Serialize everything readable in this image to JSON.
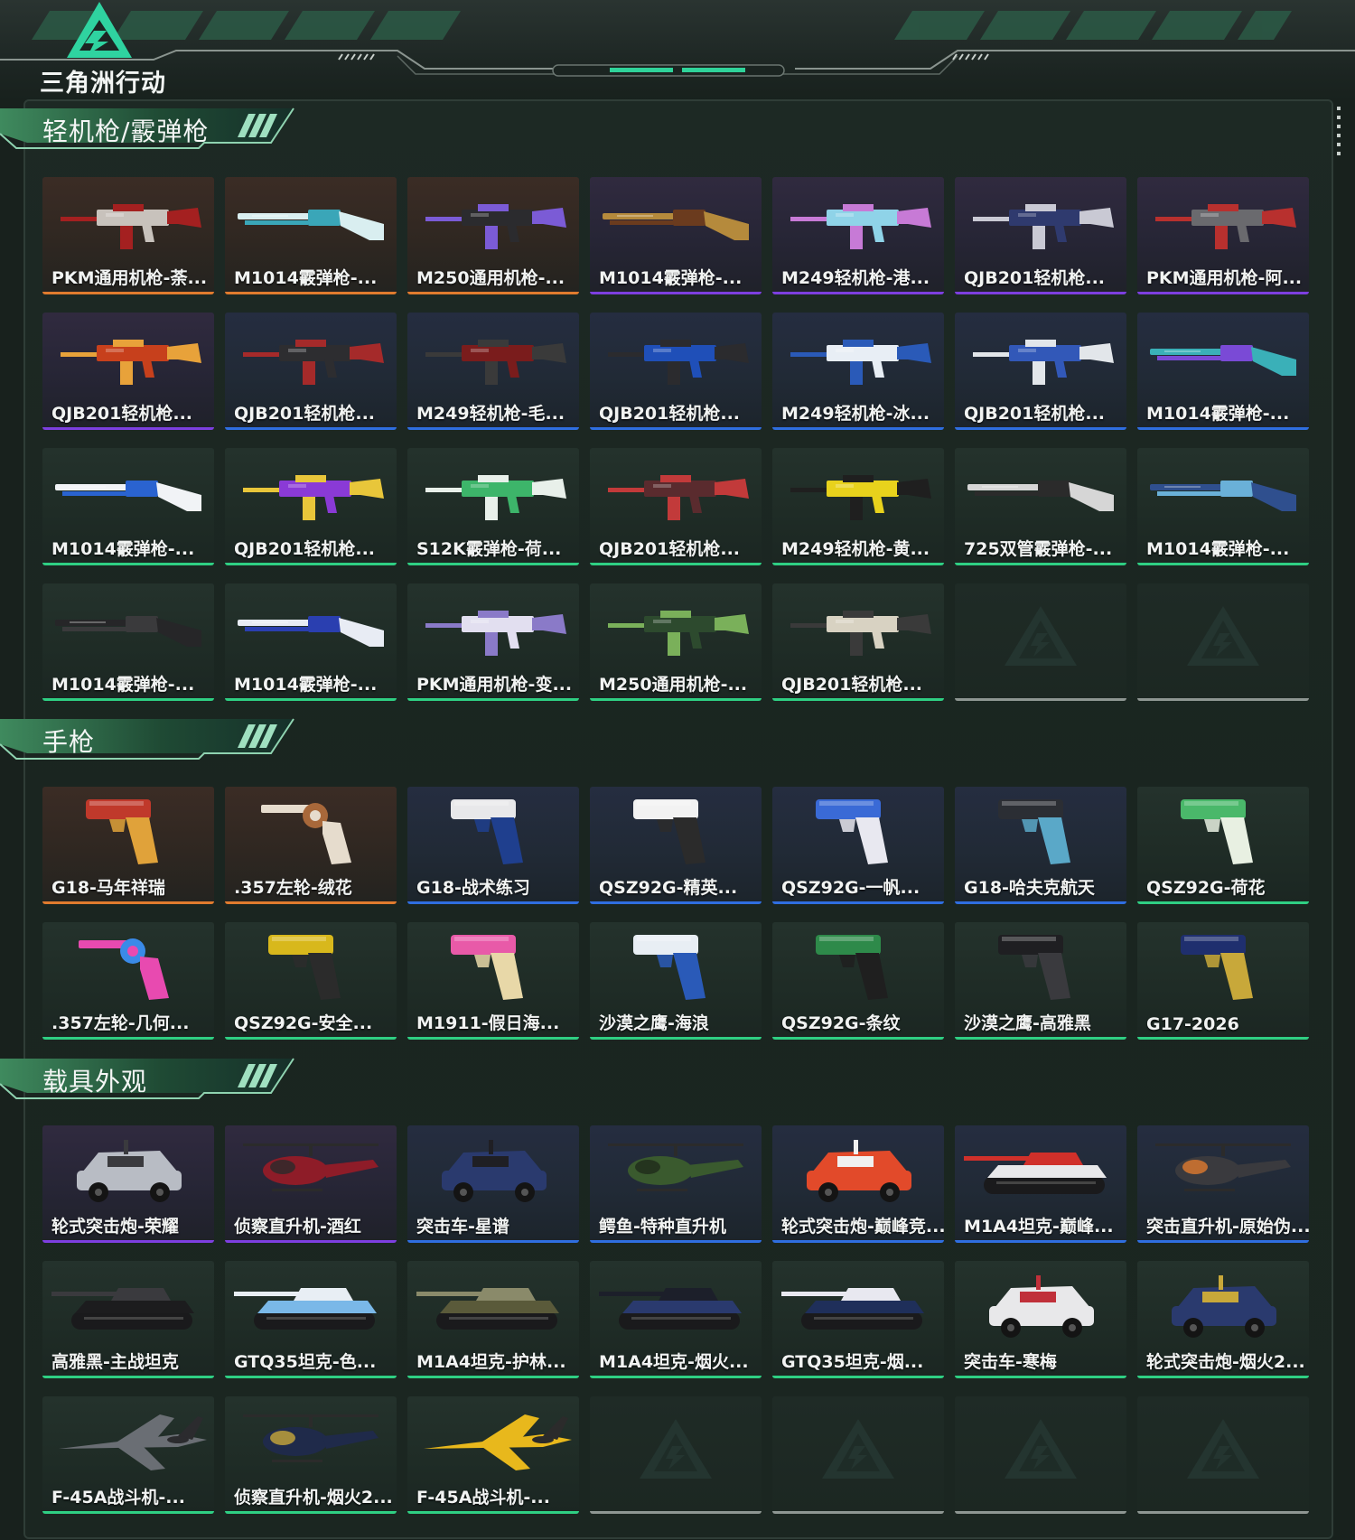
{
  "app": {
    "logo_text": "三角洲行动"
  },
  "colors": {
    "orange": "#e07b2e",
    "purple": "#7d3fe0",
    "blue": "#2f6ee0",
    "green": "#2fcf83",
    "empty": "#8e9692"
  },
  "sections": [
    {
      "title": "轻机枪/霰弹枪",
      "items": [
        {
          "label": "PKM通用机枪-荼...",
          "rarity": "orange",
          "kind": "rifle",
          "c1": "#c8c2bc",
          "c2": "#a42020"
        },
        {
          "label": "M1014霰弹枪-...",
          "rarity": "orange",
          "kind": "shotgun",
          "c1": "#d9eef0",
          "c2": "#3aa6b8"
        },
        {
          "label": "M250通用机枪-...",
          "rarity": "orange",
          "kind": "rifle",
          "c1": "#2b2b2e",
          "c2": "#7b5bd6"
        },
        {
          "label": "M1014霰弹枪-...",
          "rarity": "purple",
          "kind": "shotgun",
          "c1": "#b58a3c",
          "c2": "#6b3b1e"
        },
        {
          "label": "M249轻机枪-港...",
          "rarity": "purple",
          "kind": "rifle",
          "c1": "#8fd3e8",
          "c2": "#c77ad6"
        },
        {
          "label": "QJB201轻机枪...",
          "rarity": "purple",
          "kind": "rifle",
          "c1": "#2f3a6e",
          "c2": "#c9c9d4"
        },
        {
          "label": "PKM通用机枪-阿...",
          "rarity": "purple",
          "kind": "rifle",
          "c1": "#6a6a6e",
          "c2": "#b8302e"
        },
        {
          "label": "QJB201轻机枪...",
          "rarity": "purple",
          "kind": "rifle",
          "c1": "#c7401c",
          "c2": "#e8a23a"
        },
        {
          "label": "QJB201轻机枪...",
          "rarity": "blue",
          "kind": "rifle",
          "c1": "#2d2d30",
          "c2": "#a52a2a"
        },
        {
          "label": "M249轻机枪-毛...",
          "rarity": "blue",
          "kind": "rifle",
          "c1": "#7a1c1c",
          "c2": "#3a3a3a"
        },
        {
          "label": "QJB201轻机枪...",
          "rarity": "blue",
          "kind": "rifle",
          "c1": "#1f4fb8",
          "c2": "#2b2b2e"
        },
        {
          "label": "M249轻机枪-冰...",
          "rarity": "blue",
          "kind": "rifle",
          "c1": "#e8eef5",
          "c2": "#2a5ab8"
        },
        {
          "label": "QJB201轻机枪...",
          "rarity": "blue",
          "kind": "rifle",
          "c1": "#3258b8",
          "c2": "#e2e6ea"
        },
        {
          "label": "M1014霰弹枪-...",
          "rarity": "blue",
          "kind": "shotgun",
          "c1": "#3ab0b8",
          "c2": "#7a4ad6"
        },
        {
          "label": "M1014霰弹枪-...",
          "rarity": "green",
          "kind": "shotgun",
          "c1": "#f1f3f6",
          "c2": "#2a63d0"
        },
        {
          "label": "QJB201轻机枪...",
          "rarity": "green",
          "kind": "rifle",
          "c1": "#8a3ad6",
          "c2": "#e8c63a"
        },
        {
          "label": "S12K霰弹枪-荷...",
          "rarity": "green",
          "kind": "rifle",
          "c1": "#3db56a",
          "c2": "#e8f0ea"
        },
        {
          "label": "QJB201轻机枪...",
          "rarity": "green",
          "kind": "rifle",
          "c1": "#5a2b2e",
          "c2": "#c23a3a"
        },
        {
          "label": "M249轻机枪-黄...",
          "rarity": "green",
          "kind": "rifle",
          "c1": "#e8d21c",
          "c2": "#1f1f1f"
        },
        {
          "label": "725双管霰弹枪-...",
          "rarity": "green",
          "kind": "shotgun",
          "c1": "#d6d6d6",
          "c2": "#2b2b2b"
        },
        {
          "label": "M1014霰弹枪-...",
          "rarity": "green",
          "kind": "shotgun",
          "c1": "#2f4f8e",
          "c2": "#6ab0d8"
        },
        {
          "label": "M1014霰弹枪-...",
          "rarity": "green",
          "kind": "shotgun",
          "c1": "#262628",
          "c2": "#3a3a3c"
        },
        {
          "label": "M1014霰弹枪-...",
          "rarity": "green",
          "kind": "shotgun",
          "c1": "#e8ecf4",
          "c2": "#2a3fb0"
        },
        {
          "label": "PKM通用机枪-变...",
          "rarity": "green",
          "kind": "rifle",
          "c1": "#e2dff0",
          "c2": "#8a7ac8"
        },
        {
          "label": "M250通用机枪-...",
          "rarity": "green",
          "kind": "rifle",
          "c1": "#2d4a2e",
          "c2": "#7ab05a"
        },
        {
          "label": "QJB201轻机枪...",
          "rarity": "green",
          "kind": "rifle",
          "c1": "#d8d2c2",
          "c2": "#3a3a3a"
        },
        {
          "label": "",
          "rarity": "empty",
          "kind": "none"
        },
        {
          "label": "",
          "rarity": "empty",
          "kind": "none"
        }
      ]
    },
    {
      "title": "手枪",
      "items": [
        {
          "label": "G18-马年祥瑞",
          "rarity": "orange",
          "kind": "pistol",
          "c1": "#c0392b",
          "c2": "#e0a23a"
        },
        {
          "label": ".357左轮-绒花",
          "rarity": "orange",
          "kind": "revolver",
          "c1": "#e6dccd",
          "c2": "#a8683a"
        },
        {
          "label": "G18-战术练习",
          "rarity": "blue",
          "kind": "pistol",
          "c1": "#e8e8ea",
          "c2": "#1f3f8e"
        },
        {
          "label": "QSZ92G-精英...",
          "rarity": "blue",
          "kind": "pistol",
          "c1": "#f2f2f2",
          "c2": "#2b2b2b"
        },
        {
          "label": "QSZ92G-一帆...",
          "rarity": "blue",
          "kind": "pistol",
          "c1": "#3a6ad6",
          "c2": "#e8e8f0"
        },
        {
          "label": "G18-哈夫克航天",
          "rarity": "blue",
          "kind": "pistol",
          "c1": "#2b2e34",
          "c2": "#5aa8c8"
        },
        {
          "label": "QSZ92G-荷花",
          "rarity": "green",
          "kind": "pistol",
          "c1": "#4ab86a",
          "c2": "#e8f0e2"
        },
        {
          "label": ".357左轮-几何...",
          "rarity": "green",
          "kind": "revolver",
          "c1": "#e84ab0",
          "c2": "#3a8ae8"
        },
        {
          "label": "QSZ92G-安全...",
          "rarity": "green",
          "kind": "pistol",
          "c1": "#d8b81c",
          "c2": "#2b2b2b"
        },
        {
          "label": "M1911-假日海...",
          "rarity": "green",
          "kind": "pistol",
          "c1": "#e85aa8",
          "c2": "#e8d8a8"
        },
        {
          "label": "沙漠之鹰-海浪",
          "rarity": "green",
          "kind": "pistol",
          "c1": "#e8eef4",
          "c2": "#2a5ab8"
        },
        {
          "label": "QSZ92G-条纹",
          "rarity": "green",
          "kind": "pistol",
          "c1": "#2e8a4a",
          "c2": "#1f1f1f"
        },
        {
          "label": "沙漠之鹰-高雅黑",
          "rarity": "green",
          "kind": "pistol",
          "c1": "#1f1f22",
          "c2": "#3a3a3e"
        },
        {
          "label": "G17-2026",
          "rarity": "green",
          "kind": "pistol",
          "c1": "#1f2f6e",
          "c2": "#c8a83a"
        }
      ]
    },
    {
      "title": "载具外观",
      "items": [
        {
          "label": "轮式突击炮-荣耀",
          "rarity": "purple",
          "kind": "car",
          "c1": "#b8bcc4",
          "c2": "#3a3a3e"
        },
        {
          "label": "侦察直升机-酒红",
          "rarity": "purple",
          "kind": "heli",
          "c1": "#8e1c28",
          "c2": "#2b2b2b"
        },
        {
          "label": "突击车-星谱",
          "rarity": "blue",
          "kind": "car",
          "c1": "#2a3a6e",
          "c2": "#1f1f24"
        },
        {
          "label": "鳄鱼-特种直升机",
          "rarity": "blue",
          "kind": "heli",
          "c1": "#3a5a2e",
          "c2": "#1f2a1a"
        },
        {
          "label": "轮式突击炮-巅峰竞...",
          "rarity": "blue",
          "kind": "car",
          "c1": "#e24a2a",
          "c2": "#f0f0f0"
        },
        {
          "label": "M1A4坦克-巅峰...",
          "rarity": "blue",
          "kind": "tank",
          "c1": "#e8e8ea",
          "c2": "#d0302a"
        },
        {
          "label": "突击直升机-原始伪...",
          "rarity": "blue",
          "kind": "heli",
          "c1": "#3a3a3e",
          "c2": "#e07a2e"
        },
        {
          "label": "高雅黑-主战坦克",
          "rarity": "green",
          "kind": "tank",
          "c1": "#1c1c1e",
          "c2": "#3a3a3e"
        },
        {
          "label": "GTQ35坦克-色...",
          "rarity": "green",
          "kind": "tank",
          "c1": "#7ab8e8",
          "c2": "#e8eef4"
        },
        {
          "label": "M1A4坦克-护林...",
          "rarity": "green",
          "kind": "tank",
          "c1": "#5a5a3a",
          "c2": "#8a8a6a"
        },
        {
          "label": "M1A4坦克-烟火...",
          "rarity": "green",
          "kind": "tank",
          "c1": "#2a3a6e",
          "c2": "#1c1f2a"
        },
        {
          "label": "GTQ35坦克-烟...",
          "rarity": "green",
          "kind": "tank",
          "c1": "#1f2f5a",
          "c2": "#e8e8f0"
        },
        {
          "label": "突击车-寒梅",
          "rarity": "green",
          "kind": "car",
          "c1": "#e8e8ea",
          "c2": "#c0303a"
        },
        {
          "label": "轮式突击炮-烟火2...",
          "rarity": "green",
          "kind": "car",
          "c1": "#2a3a6e",
          "c2": "#c8a83a"
        },
        {
          "label": "F-45A战斗机-...",
          "rarity": "green",
          "kind": "jet",
          "c1": "#6a6e74",
          "c2": "#2b2b2e"
        },
        {
          "label": "侦察直升机-烟火2...",
          "rarity": "green",
          "kind": "heli",
          "c1": "#1f2a4a",
          "c2": "#c8a83a"
        },
        {
          "label": "F-45A战斗机-...",
          "rarity": "green",
          "kind": "jet",
          "c1": "#e8b81c",
          "c2": "#2b2b2b"
        },
        {
          "label": "",
          "rarity": "empty",
          "kind": "none"
        },
        {
          "label": "",
          "rarity": "empty",
          "kind": "none"
        },
        {
          "label": "",
          "rarity": "empty",
          "kind": "none"
        },
        {
          "label": "",
          "rarity": "empty",
          "kind": "none"
        }
      ]
    }
  ]
}
